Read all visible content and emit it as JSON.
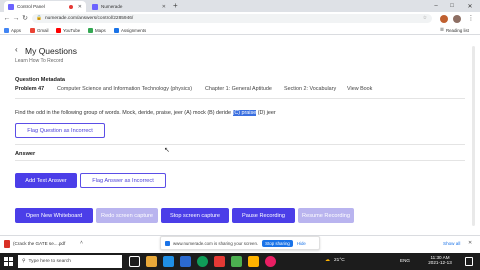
{
  "browser": {
    "tabs": [
      {
        "title": "Control Panel",
        "recording": true,
        "active": true
      },
      {
        "title": "Numerade",
        "recording": false,
        "active": false
      }
    ],
    "new_tab": "+",
    "url": "numerade.com/answers/control/2285946/",
    "bookmarks": [
      "Apps",
      "Gmail",
      "YouTube",
      "Maps",
      "Assignments"
    ],
    "reading_list": "Reading list"
  },
  "page": {
    "heading": "My Questions",
    "sublink": "Learn How To Record",
    "meta_title": "Question Metadata",
    "meta_items": [
      "Problem 47",
      "Computer Science and Information Technology (physics)",
      "Chapter 1: General Aptitude",
      "Section 2: Vocabulary",
      "View Book"
    ],
    "question_prefix": "Find the odd in the following group of words. Mock, deride, praise, jeer (A) mock (B) deride",
    "question_highlight": "(C) praise",
    "question_suffix": "(D) jeer",
    "flag_question": "Flag Question as Incorrect",
    "answer_label": "Answer",
    "add_answer": "Add Text Answer",
    "flag_answer": "Flag Answer as Incorrect",
    "controls": [
      "Open New Whiteboard",
      "Redo screen capture",
      "Stop screen capture",
      "Pause Recording",
      "Resume Recording"
    ]
  },
  "downloads": {
    "file": "(Crack the GATE se....pdf",
    "show_all": "Show all"
  },
  "share": {
    "text": "www.numerade.com is sharing your screen.",
    "stop": "Stop sharing",
    "hide": "Hide"
  },
  "taskbar": {
    "search": "Type here to search",
    "temp": "21°C",
    "lang": "ENG",
    "time": "11:30 AM",
    "date": "2021-12-13"
  },
  "colors": {
    "accent": "#4b3ee8",
    "highlight": "#3a6fe0"
  }
}
